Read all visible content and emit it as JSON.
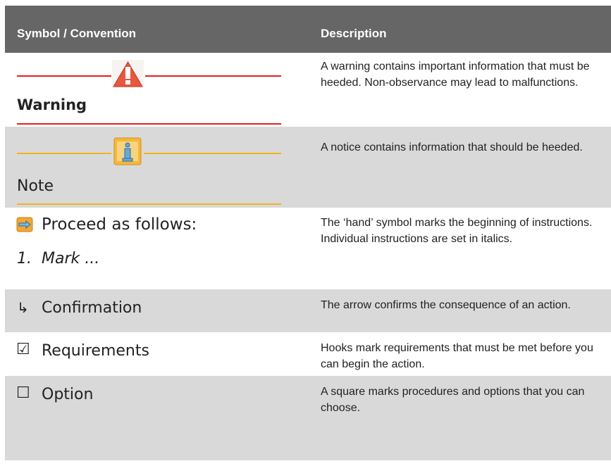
{
  "header": {
    "col1": "Symbol / Convention",
    "col2": "Description"
  },
  "rows": [
    {
      "symbol": "Warning",
      "description": "A warning contains important information that must be heeded. Non-observance may lead to malfunctions."
    },
    {
      "symbol": "Note",
      "description": "A notice contains information that should be heeded."
    },
    {
      "symbol": "Proceed as follows:",
      "step": "1.",
      "step_text": "Mark ...",
      "description": "The ‘hand’ symbol marks the beginning of instructions. Individual instructions are set in italics."
    },
    {
      "symbol": "Confirmation",
      "glyph": "↳",
      "description": "The arrow confirms the consequence of an action."
    },
    {
      "symbol": "Requirements",
      "glyph": "☑",
      "description": "Hooks mark requirements that must be met before you can begin the action."
    },
    {
      "symbol": "Option",
      "glyph": "☐",
      "description": "A square marks procedures and options that you can choose."
    }
  ],
  "colors": {
    "header_bg": "#666666",
    "row_gray": "#d9d9d9",
    "warning_red": "#e01e24",
    "note_yellow": "#f2b41c"
  },
  "icons": [
    "warning-triangle-icon",
    "info-note-icon",
    "hand-pointing-icon",
    "arrow-confirm-icon",
    "checked-box-icon",
    "empty-box-icon"
  ]
}
